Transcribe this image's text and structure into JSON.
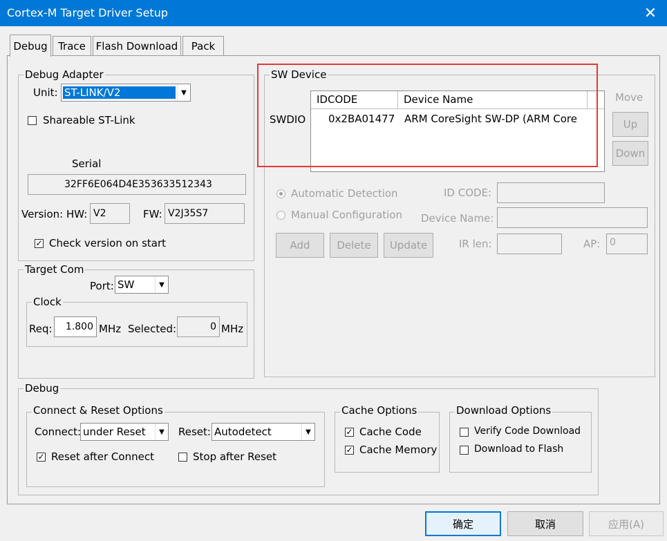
{
  "window": {
    "title": "Cortex-M Target Driver Setup",
    "close_glyph": "✕"
  },
  "tabs": [
    {
      "label": "Debug",
      "active": true
    },
    {
      "label": "Trace"
    },
    {
      "label": "Flash Download"
    },
    {
      "label": "Pack"
    }
  ],
  "debug_adapter": {
    "title": "Debug Adapter",
    "unit_label": "Unit:",
    "unit_value": "ST-LINK/V2",
    "shareable_label": "Shareable ST-Link",
    "shareable_checked": false,
    "serial_label": "Serial",
    "serial_value": "32FF6E064D4E353633512343",
    "version_hw_label": "Version: HW:",
    "hw_value": "V2",
    "fw_label": "FW:",
    "fw_value": "V2J35S7",
    "check_version_label": "Check version on start",
    "check_version_checked": true
  },
  "target_com": {
    "title": "Target Com",
    "port_label": "Port:",
    "port_value": "SW",
    "clock_title": "Clock",
    "req_label": "Req:",
    "req_value": "1.800",
    "mhz1": "MHz",
    "selected_label": "Selected:",
    "selected_value": "0",
    "mhz2": "MHz"
  },
  "sw_device": {
    "title": "SW Device",
    "col_idcode": "IDCODE",
    "col_device_name": "Device Name",
    "row_label": "SWDIO",
    "row_idcode": "0x2BA01477",
    "row_device_name": "ARM CoreSight SW-DP (ARM Core",
    "move_label": "Move",
    "up_label": "Up",
    "down_label": "Down",
    "auto_detect_label": "Automatic Detection",
    "auto_detect_selected": true,
    "manual_config_label": "Manual Configuration",
    "id_code_label": "ID CODE:",
    "device_name_label": "Device Name:",
    "add_label": "Add",
    "delete_label": "Delete",
    "update_label": "Update",
    "ir_len_label": "IR len:",
    "ap_label": "AP:",
    "ap_value": "0"
  },
  "debug": {
    "title": "Debug",
    "connect_reset_title": "Connect & Reset Options",
    "connect_label": "Connect:",
    "connect_value": "under Reset",
    "reset_label": "Reset:",
    "reset_value": "Autodetect",
    "reset_after_connect_label": "Reset after Connect",
    "reset_after_connect_checked": true,
    "stop_after_reset_label": "Stop after Reset",
    "stop_after_reset_checked": false,
    "cache_title": "Cache Options",
    "cache_code_label": "Cache Code",
    "cache_code_checked": true,
    "cache_memory_label": "Cache Memory",
    "cache_memory_checked": true,
    "download_title": "Download Options",
    "verify_label": "Verify Code Download",
    "verify_checked": false,
    "download_flash_label": "Download to Flash",
    "download_flash_checked": false
  },
  "footer": {
    "ok_label": "确定",
    "cancel_label": "取消",
    "apply_label": "应用(A)"
  },
  "icons": {
    "check": "✓",
    "dropdown": "▼"
  },
  "colors": {
    "titlebar": "#0078d7",
    "highlight": "#e53935",
    "selection": "#0078d7"
  }
}
